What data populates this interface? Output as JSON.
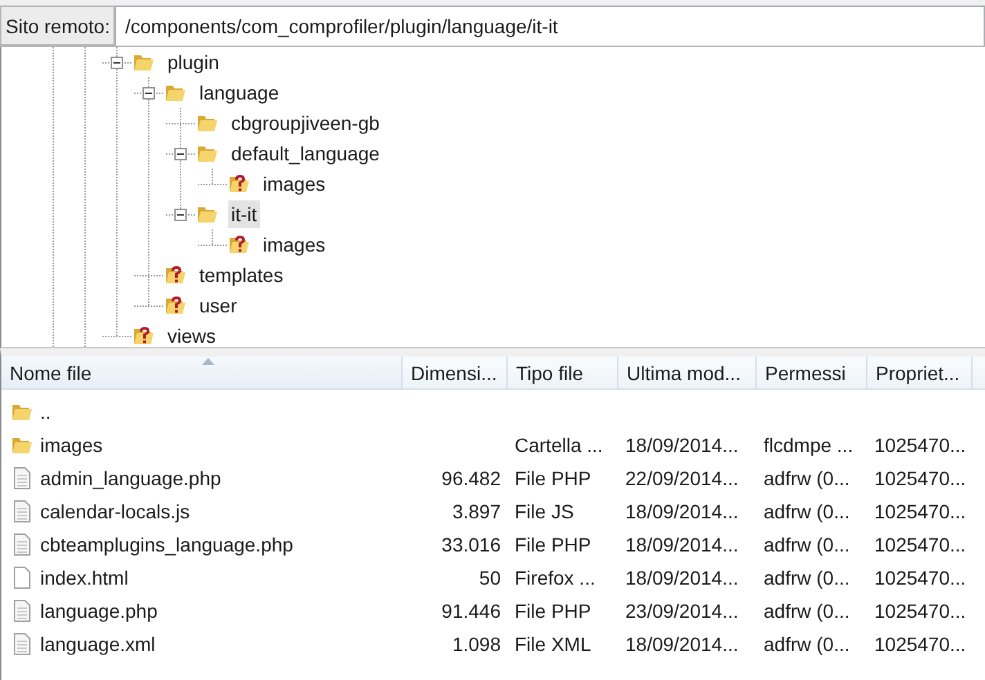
{
  "address_bar": {
    "label": "Sito remoto:",
    "value": "/components/com_comprofiler/plugin/language/it-it"
  },
  "tree": [
    {
      "label": "plugin",
      "kind": "folder",
      "expanded": true,
      "selected": false,
      "children": [
        {
          "label": "language",
          "kind": "folder",
          "expanded": true,
          "selected": false,
          "children": [
            {
              "label": "cbgroupjiveen-gb",
              "kind": "folder",
              "selected": false
            },
            {
              "label": "default_language",
              "kind": "folder",
              "expanded": true,
              "selected": false,
              "children": [
                {
                  "label": "images",
                  "kind": "unknown",
                  "selected": false
                }
              ]
            },
            {
              "label": "it-it",
              "kind": "folder",
              "expanded": true,
              "selected": true,
              "children": [
                {
                  "label": "images",
                  "kind": "unknown",
                  "selected": false
                }
              ]
            }
          ]
        },
        {
          "label": "templates",
          "kind": "unknown",
          "selected": false
        },
        {
          "label": "user",
          "kind": "unknown",
          "selected": false
        }
      ]
    },
    {
      "label": "views",
      "kind": "unknown",
      "selected": false
    }
  ],
  "file_list": {
    "columns": [
      {
        "label": "Nome file",
        "sorted": true
      },
      {
        "label": "Dimensi...",
        "sorted": false
      },
      {
        "label": "Tipo file",
        "sorted": false
      },
      {
        "label": "Ultima mod...",
        "sorted": false
      },
      {
        "label": "Permessi",
        "sorted": false
      },
      {
        "label": "Propriet...",
        "sorted": false
      }
    ],
    "rows": [
      {
        "kind": "folder",
        "name": "..",
        "size": "",
        "type": "",
        "modified": "",
        "permissions": "",
        "owner": ""
      },
      {
        "kind": "folder",
        "name": "images",
        "size": "",
        "type": "Cartella ...",
        "modified": "18/09/2014...",
        "permissions": "flcdmpe ...",
        "owner": "1025470..."
      },
      {
        "kind": "file",
        "name": "admin_language.php",
        "size": "96.482",
        "type": "File PHP",
        "modified": "22/09/2014...",
        "permissions": "adfrw (0...",
        "owner": "1025470..."
      },
      {
        "kind": "file",
        "name": "calendar-locals.js",
        "size": "3.897",
        "type": "File JS",
        "modified": "18/09/2014...",
        "permissions": "adfrw (0...",
        "owner": "1025470..."
      },
      {
        "kind": "file",
        "name": "cbteamplugins_language.php",
        "size": "33.016",
        "type": "File PHP",
        "modified": "18/09/2014...",
        "permissions": "adfrw (0...",
        "owner": "1025470..."
      },
      {
        "kind": "blank",
        "name": "index.html",
        "size": "50",
        "type": "Firefox ...",
        "modified": "18/09/2014...",
        "permissions": "adfrw (0...",
        "owner": "1025470..."
      },
      {
        "kind": "file",
        "name": "language.php",
        "size": "91.446",
        "type": "File PHP",
        "modified": "23/09/2014...",
        "permissions": "adfrw (0...",
        "owner": "1025470..."
      },
      {
        "kind": "file",
        "name": "language.xml",
        "size": "1.098",
        "type": "File XML",
        "modified": "18/09/2014...",
        "permissions": "adfrw (0...",
        "owner": "1025470..."
      }
    ]
  }
}
